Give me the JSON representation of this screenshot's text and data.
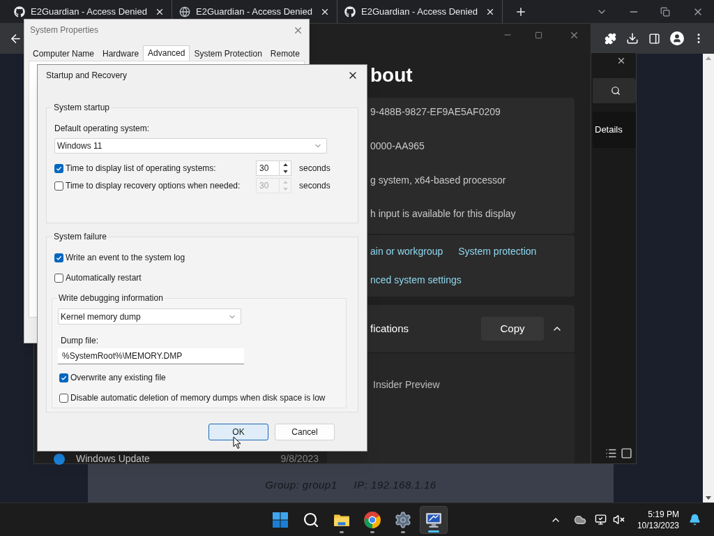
{
  "browser": {
    "tabs": [
      {
        "title": "E2Guardian - Access Denied",
        "kind": "github"
      },
      {
        "title": "E2Guardian - Access Denied",
        "kind": "globe"
      },
      {
        "title": "E2Guardian - Access Denied",
        "kind": "github"
      }
    ]
  },
  "page": {
    "group": "Group: group1",
    "ip": "IP: 192.168.1.16"
  },
  "settings_window": {
    "heading": "bout",
    "device_rows": [
      "9-488B-9827-EF9AE5AF0209",
      "0000-AA965",
      "g system, x64-based processor",
      "h input is available for this display"
    ],
    "link_rows": [
      {
        "links": [
          "ain or workgroup",
          "System protection"
        ]
      },
      {
        "links": [
          "nced system settings"
        ]
      }
    ],
    "specs": {
      "title": "fications",
      "copy_button": "Copy",
      "expanded": true
    },
    "edition": "Insider Preview",
    "update": {
      "label": "Windows Update",
      "date": "9/8/2023"
    }
  },
  "side_window": {
    "tab": "Details"
  },
  "system_properties": {
    "title": "System Properties",
    "tabs": [
      {
        "label": "Computer Name",
        "selected": false
      },
      {
        "label": "Hardware",
        "selected": false
      },
      {
        "label": "Advanced",
        "selected": true
      },
      {
        "label": "System Protection",
        "selected": false
      },
      {
        "label": "Remote",
        "selected": false
      }
    ]
  },
  "dialog": {
    "title": "Startup and Recovery",
    "startup": {
      "legend": "System startup",
      "default_os_label": "Default operating system:",
      "default_os": "Windows 11",
      "options": [
        {
          "label": "Time to display list of operating systems:",
          "checked": true,
          "value": "30",
          "unit": "seconds",
          "disabled": false
        },
        {
          "label": "Time to display recovery options when needed:",
          "checked": false,
          "value": "30",
          "unit": "seconds",
          "disabled": true
        }
      ]
    },
    "failure": {
      "legend": "System failure",
      "options": [
        {
          "label": "Write an event to the system log",
          "checked": true
        },
        {
          "label": "Automatically restart",
          "checked": false
        }
      ],
      "debug": {
        "legend": "Write debugging information",
        "dump_type": "Kernel memory dump",
        "dump_file_label": "Dump file:",
        "dump_file": "%SystemRoot%\\MEMORY.DMP",
        "options": [
          {
            "label": "Overwrite any existing file",
            "checked": true
          },
          {
            "label": "Disable automatic deletion of memory dumps when disk space is low",
            "checked": false
          }
        ]
      }
    },
    "buttons": [
      {
        "label": "OK",
        "selected": true
      },
      {
        "label": "Cancel",
        "selected": false
      }
    ]
  },
  "taskbar": {
    "apps": [
      {
        "kind": "start",
        "running": false,
        "selected": false
      },
      {
        "kind": "search",
        "running": false,
        "selected": false
      },
      {
        "kind": "explorer",
        "running": true,
        "selected": false
      },
      {
        "kind": "chrome",
        "running": true,
        "selected": false
      },
      {
        "kind": "settings",
        "running": true,
        "selected": false
      },
      {
        "kind": "remote",
        "running": true,
        "selected": true
      }
    ],
    "time": "5:19 PM",
    "date": "10/13/2023"
  }
}
